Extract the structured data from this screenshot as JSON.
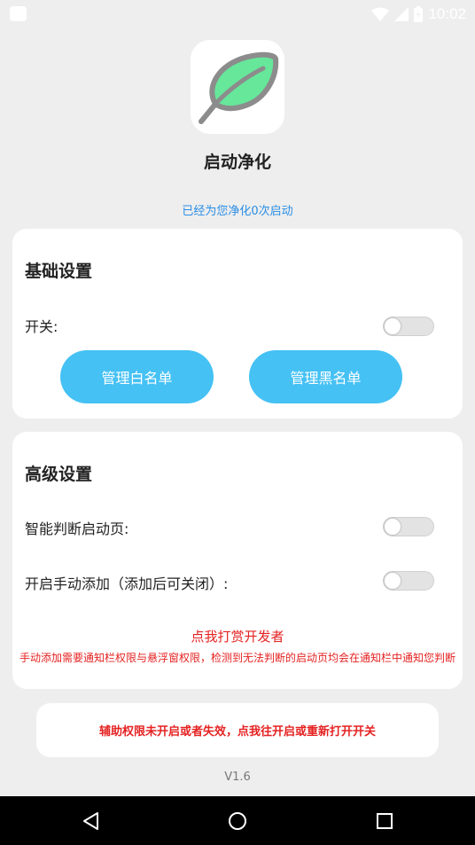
{
  "status_bar": {
    "time": "10:02"
  },
  "app": {
    "name": "启动净化",
    "counter_text": "已经为您净化0次启动",
    "icon": "leaf-icon",
    "icon_colors": {
      "leaf": "#66e79a",
      "outline": "#8c8c8c"
    }
  },
  "basic": {
    "title": "基础设置",
    "switch_label": "开关:",
    "switch_on": false,
    "whitelist_button": "管理白名单",
    "blacklist_button": "管理黑名单"
  },
  "advanced": {
    "title": "高级设置",
    "smart_detect_label": "智能判断启动页:",
    "smart_detect_on": false,
    "manual_add_label": "开启手动添加（添加后可关闭）:",
    "manual_add_on": false,
    "donate_link": "点我打赏开发者",
    "notice": "手动添加需要通知栏权限与悬浮窗权限，检测到无法判断的启动页均会在通知栏中通知您判断"
  },
  "accessibility_warning": "辅助权限未开启或者失效，点我往开启或重新打开开关",
  "version": "V1.6",
  "colors": {
    "accent": "#45c1f4",
    "warning": "#e52222",
    "link": "#2a8ee6"
  },
  "nav_bar": {
    "back_icon": "back-triangle-icon",
    "home_icon": "home-circle-icon",
    "recents_icon": "recents-square-icon"
  }
}
